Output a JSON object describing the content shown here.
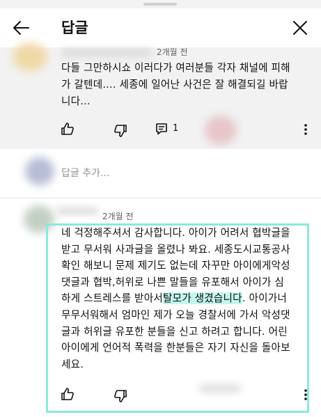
{
  "header": {
    "title": "답글"
  },
  "parent_comment": {
    "timestamp": "2개월 전",
    "text_lines": [
      "다들 그만하시쇼 이러다가 여러분들 각자 채널에 피해",
      "가 갈텐데.... 세종에 일어난 사건은 잘 해결되길 바랍",
      "니다..."
    ],
    "reply_count": "1"
  },
  "add_reply": {
    "placeholder": "답글 추가..."
  },
  "reply_comment": {
    "timestamp": "2개월 전",
    "text_lines": [
      "네 걱정해주셔서 감사합니다. 아이가 어려서 협박글을",
      "받고 무서워 사과글을 올렸나 봐요. 세종도시교통공사",
      "확인 해보니 문제 제기도 없는데 자꾸만 아이에게악성",
      "댓글과 협박,허위로 나쁜 말들을 유포해서 아이가 심",
      "하게 스트레스를 받아서",
      "탈모가 생겼습니다",
      ". 아이가너",
      "무무서워해서 엄마인 제가 오늘 경찰서에 가서 악성댓",
      "글과 허위글 유포한 분들을 신고 하려고 합니다. 어린",
      "아이에게 언어적 폭력을 한분들은 자기 자신을 돌아보",
      "세요."
    ]
  },
  "colors": {
    "highlight_border": "#8ce8dc",
    "highlight_fill": "#c3f5ee",
    "parent_bg": "#f2f2f2"
  },
  "icons": [
    "back-arrow-icon",
    "close-icon",
    "like-icon",
    "dislike-icon",
    "reply-icon",
    "more-icon"
  ]
}
